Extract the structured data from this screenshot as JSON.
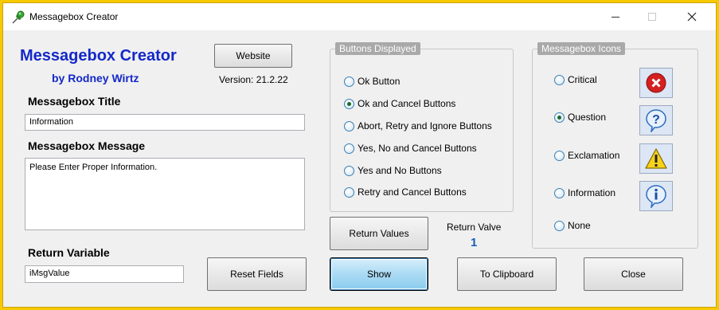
{
  "window": {
    "title": "Messagebox Creator"
  },
  "header": {
    "app_title": "Messagebox Creator",
    "author": "by Rodney Wirtz",
    "website_label": "Website",
    "version": "Version: 21.2.22"
  },
  "form": {
    "title_label": "Messagebox Title",
    "title_value": "Information",
    "message_label": "Messagebox Message",
    "message_value": "Please Enter Proper Information.",
    "return_var_label": "Return Variable",
    "return_var_value": "iMsgValue"
  },
  "buttons_group": {
    "title": "Buttons Displayed",
    "options": [
      {
        "label": "Ok Button",
        "checked": false
      },
      {
        "label": "Ok and Cancel Buttons",
        "checked": true
      },
      {
        "label": "Abort, Retry and Ignore Buttons",
        "checked": false
      },
      {
        "label": "Yes, No and Cancel Buttons",
        "checked": false
      },
      {
        "label": "Yes and No Buttons",
        "checked": false
      },
      {
        "label": "Retry and Cancel Buttons",
        "checked": false
      }
    ]
  },
  "icons_group": {
    "title": "Messagebox Icons",
    "options": [
      {
        "label": "Critical",
        "checked": false,
        "icon": "critical-icon"
      },
      {
        "label": "Question",
        "checked": true,
        "icon": "question-icon"
      },
      {
        "label": "Exclamation",
        "checked": false,
        "icon": "exclamation-icon"
      },
      {
        "label": "Information",
        "checked": false,
        "icon": "information-icon"
      },
      {
        "label": "None",
        "checked": false,
        "icon": ""
      }
    ]
  },
  "return": {
    "button_label": "Return Values",
    "valve_label": "Return Valve",
    "valve_value": "1"
  },
  "actions": {
    "reset": "Reset Fields",
    "show": "Show",
    "clipboard": "To Clipboard",
    "close": "Close"
  },
  "colors": {
    "frame": "#f7c900",
    "brand": "#1428c8",
    "return_value": "#1a5fb4",
    "group_title_bg": "#a9a9a9"
  }
}
